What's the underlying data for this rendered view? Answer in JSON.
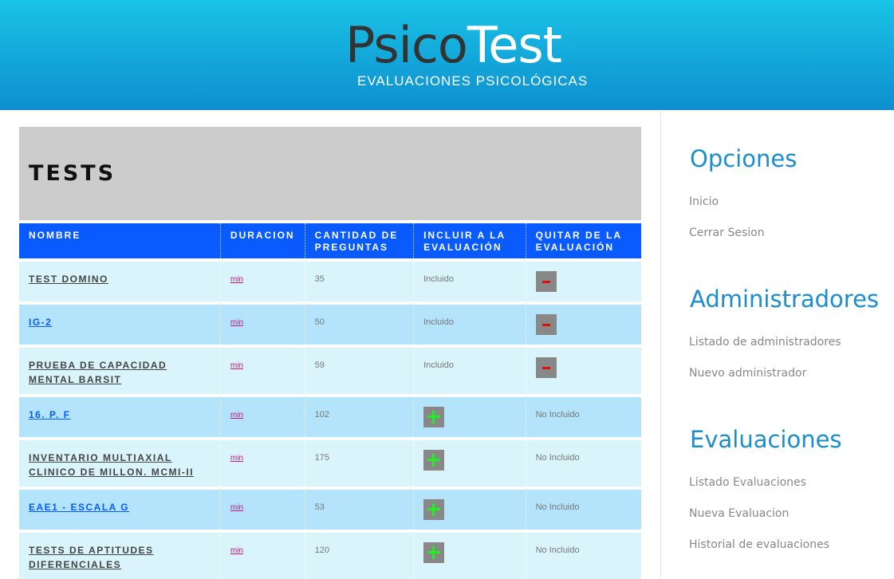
{
  "header": {
    "logo_psico": "Psico",
    "logo_test": "Test",
    "subtitle": "EVALUACIONES PSICOLÓGICAS"
  },
  "main": {
    "title": "TESTS",
    "columns": [
      "NOMBRE",
      "DURACION",
      "CANTIDAD DE PREGUNTAS",
      "INCLUIR A LA EVALUACIÓN",
      "QUITAR DE LA EVALUACIÓN"
    ],
    "rows": [
      {
        "name": "TEST DOMINO",
        "duration": "min",
        "questions": "35",
        "include": "Incluido",
        "remove": "",
        "included": true
      },
      {
        "name": "IG-2",
        "duration": "min",
        "questions": "50",
        "include": "Incluido",
        "remove": "",
        "included": true
      },
      {
        "name": "PRUEBA DE CAPACIDAD MENTAL BARSIT",
        "duration": "min",
        "questions": "59",
        "include": "Incluido",
        "remove": "",
        "included": true
      },
      {
        "name": "16. P. F",
        "duration": "min",
        "questions": "102",
        "include": "",
        "remove": "No Incluido",
        "included": false
      },
      {
        "name": "INVENTARIO MULTIAXIAL CLINICO DE MILLON. MCMI-II",
        "duration": "min",
        "questions": "175",
        "include": "",
        "remove": "No Incluido",
        "included": false
      },
      {
        "name": "EAE1 - ESCALA G",
        "duration": "min",
        "questions": "53",
        "include": "",
        "remove": "No Incluido",
        "included": false
      },
      {
        "name": "TESTS DE APTITUDES DIFERENCIALES",
        "duration": "min",
        "questions": "120",
        "include": "",
        "remove": "No Incluido",
        "included": false
      }
    ]
  },
  "sidebar": {
    "sections": [
      {
        "heading": "Opciones",
        "links": [
          "Inicio",
          "Cerrar Sesion"
        ]
      },
      {
        "heading": "Administradores",
        "links": [
          "Listado de administradores",
          "Nuevo administrador"
        ]
      },
      {
        "heading": "Evaluaciones",
        "links": [
          "Listado Evaluaciones",
          "Nueva Evaluacion",
          "Historial de evaluaciones"
        ]
      }
    ]
  },
  "colors": {
    "header_top": "#19c3e6",
    "header_bottom": "#0e8fcf",
    "table_header": "#0a5bff",
    "row_light": "#d9f5fb",
    "row_dark": "#b4e4fb",
    "sidebar_heading": "#1a8ed1"
  },
  "icons": {
    "add": "plus-icon",
    "remove": "minus-icon"
  }
}
